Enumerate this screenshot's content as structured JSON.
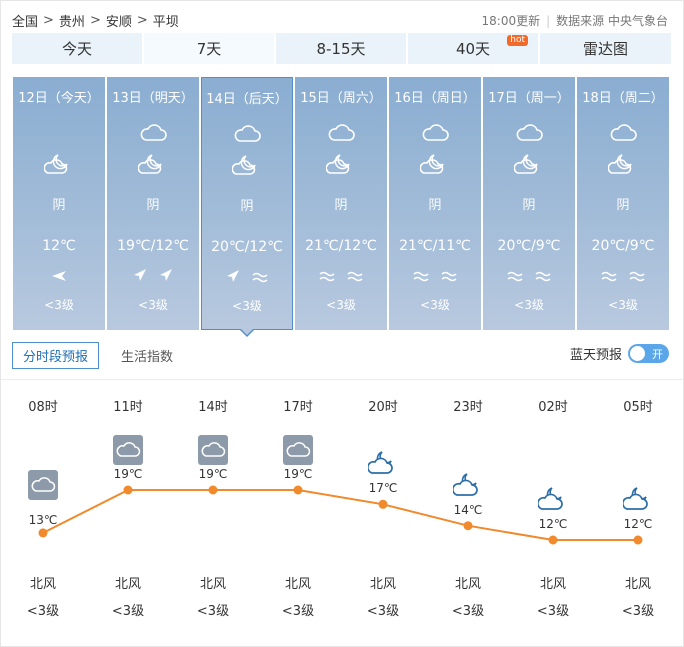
{
  "breadcrumb": [
    "全国",
    "贵州",
    "安顺",
    "平坝"
  ],
  "breadcrumb_sep": ">",
  "update_time": "18:00更新",
  "source": "数据来源 中央气象台",
  "tabs": [
    {
      "label": "今天",
      "hot": ""
    },
    {
      "label": "7天",
      "hot": "",
      "active": true
    },
    {
      "label": "8-15天",
      "hot": ""
    },
    {
      "label": "40天",
      "hot": "hot"
    },
    {
      "label": "雷达图",
      "hot": ""
    }
  ],
  "days": [
    {
      "date": "12日（今天）",
      "icon_day": "",
      "icon_night": "cloudy-moon-icon",
      "condition": "阴",
      "temp": "12℃",
      "wind": [
        "arrow-left-icon"
      ],
      "level": "<3级"
    },
    {
      "date": "13日（明天）",
      "icon_day": "cloudy-icon",
      "icon_night": "cloudy-moon-icon",
      "condition": "阴",
      "temp": "19℃/12℃",
      "wind": [
        "arrow-northeast-icon",
        "arrow-northeast-icon"
      ],
      "level": "<3级"
    },
    {
      "date": "14日（后天）",
      "icon_day": "cloudy-icon",
      "icon_night": "cloudy-moon-icon",
      "condition": "阴",
      "temp": "20℃/12℃",
      "wind": [
        "arrow-northeast-icon",
        "wave-icon"
      ],
      "level": "<3级",
      "selected": true
    },
    {
      "date": "15日（周六）",
      "icon_day": "cloudy-icon",
      "icon_night": "cloudy-moon-icon",
      "condition": "阴",
      "temp": "21℃/12℃",
      "wind": [
        "wave-icon",
        "wave-icon"
      ],
      "level": "<3级"
    },
    {
      "date": "16日（周日）",
      "icon_day": "cloudy-icon",
      "icon_night": "cloudy-moon-icon",
      "condition": "阴",
      "temp": "21℃/11℃",
      "wind": [
        "wave-icon",
        "wave-icon"
      ],
      "level": "<3级"
    },
    {
      "date": "17日（周一）",
      "icon_day": "cloudy-icon",
      "icon_night": "cloudy-moon-icon",
      "condition": "阴",
      "temp": "20℃/9℃",
      "wind": [
        "wave-icon",
        "wave-icon"
      ],
      "level": "<3级"
    },
    {
      "date": "18日（周二）",
      "icon_day": "cloudy-icon",
      "icon_night": "cloudy-moon-icon",
      "condition": "阴",
      "temp": "20℃/9℃",
      "wind": [
        "wave-icon",
        "wave-icon"
      ],
      "level": "<3级"
    }
  ],
  "subtabs": [
    {
      "label": "分时段预报",
      "active": true
    },
    {
      "label": "生活指数",
      "active": false
    }
  ],
  "bluesky": {
    "label": "蓝天预报",
    "toggle_label": "开"
  },
  "hourly": [
    {
      "time": "08时",
      "icon": "cloudy-icon",
      "temp": "13℃",
      "temp_value": 13,
      "wind": "北风",
      "level": "<3级"
    },
    {
      "time": "11时",
      "icon": "cloudy-icon",
      "temp": "19℃",
      "temp_value": 19,
      "wind": "北风",
      "level": "<3级"
    },
    {
      "time": "14时",
      "icon": "cloudy-icon",
      "temp": "19℃",
      "temp_value": 19,
      "wind": "北风",
      "level": "<3级"
    },
    {
      "time": "17时",
      "icon": "cloudy-icon",
      "temp": "19℃",
      "temp_value": 19,
      "wind": "北风",
      "level": "<3级"
    },
    {
      "time": "20时",
      "icon": "cloudy-moon-icon",
      "temp": "17℃",
      "temp_value": 17,
      "wind": "北风",
      "level": "<3级"
    },
    {
      "time": "23时",
      "icon": "cloudy-moon-icon",
      "temp": "14℃",
      "temp_value": 14,
      "wind": "北风",
      "level": "<3级"
    },
    {
      "time": "02时",
      "icon": "cloudy-moon-icon",
      "temp": "12℃",
      "temp_value": 12,
      "wind": "北风",
      "level": "<3级"
    },
    {
      "time": "05时",
      "icon": "cloudy-moon-icon",
      "temp": "12℃",
      "temp_value": 12,
      "wind": "北风",
      "level": "<3级"
    }
  ],
  "colors": {
    "line": "#f08a2c",
    "card": "#8aadd1",
    "accent": "#4f8fcb",
    "toggle": "#5ba6e8",
    "hot": "#f26a2a"
  }
}
